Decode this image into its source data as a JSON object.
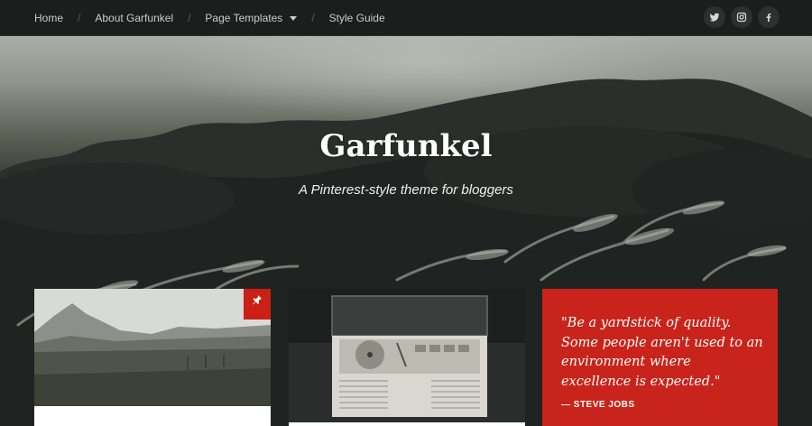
{
  "nav": {
    "items": [
      {
        "label": "Home"
      },
      {
        "label": "About Garfunkel"
      },
      {
        "label": "Page Templates"
      },
      {
        "label": "Style Guide"
      }
    ],
    "separator": "/",
    "socials": [
      {
        "icon": "twitter-icon"
      },
      {
        "icon": "instagram-icon"
      },
      {
        "icon": "facebook-icon"
      }
    ]
  },
  "hero": {
    "title": "Garfunkel",
    "tagline": "A Pinterest-style theme for bloggers"
  },
  "posts": [
    {
      "type": "image",
      "image": "landscape with mountain and field",
      "sticky": true,
      "icon": "pin-icon"
    },
    {
      "type": "image",
      "image": "vintage record player",
      "sticky": false
    },
    {
      "type": "quote",
      "quote": "\"Be a yardstick of quality. Some people aren't used to an environment where excellence is expected.\"",
      "author": "— STEVE JOBS"
    }
  ],
  "colors": {
    "nav_bg": "#1b1e1d",
    "accent_red": "#c9241b",
    "text_light": "#c9cdca"
  }
}
